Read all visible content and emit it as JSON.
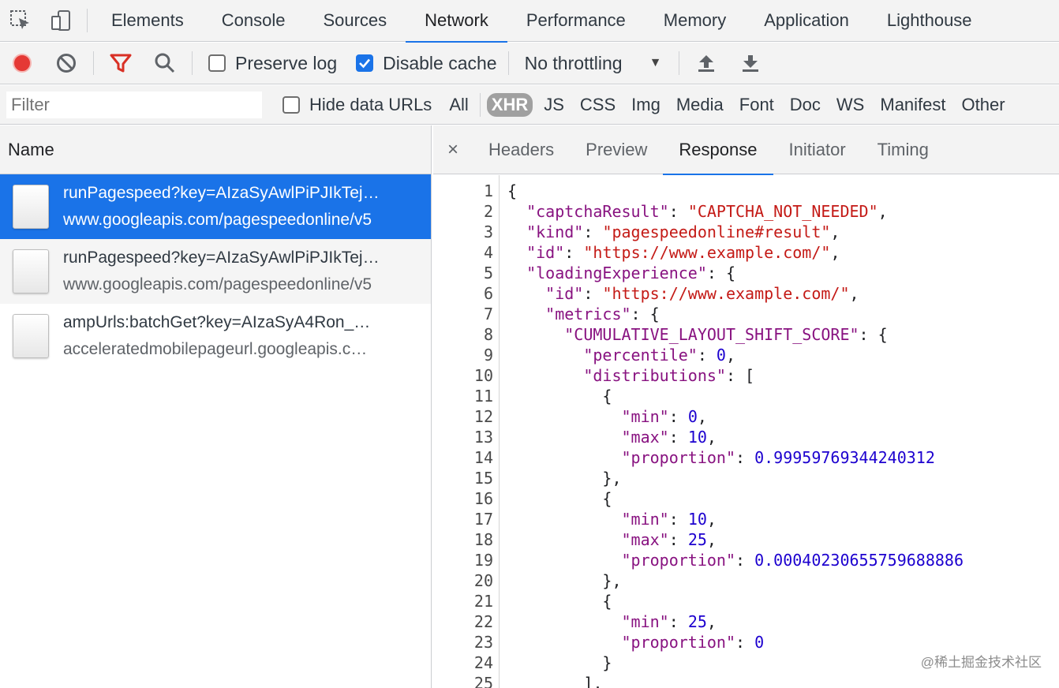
{
  "tabbar": {
    "tabs": [
      "Elements",
      "Console",
      "Sources",
      "Network",
      "Performance",
      "Memory",
      "Application",
      "Lighthouse"
    ],
    "active": "Network"
  },
  "toolbar": {
    "preserve_log": "Preserve log",
    "preserve_log_checked": false,
    "disable_cache": "Disable cache",
    "disable_cache_checked": true,
    "throttling": "No throttling"
  },
  "filterbar": {
    "placeholder": "Filter",
    "hide_data_urls": "Hide data URLs",
    "types": [
      "All",
      "XHR",
      "JS",
      "CSS",
      "Img",
      "Media",
      "Font",
      "Doc",
      "WS",
      "Manifest",
      "Other"
    ],
    "active_type": "XHR"
  },
  "requests": {
    "header": "Name",
    "items": [
      {
        "name": "runPagespeed?key=AIzaSyAwlPiPJIkTej…",
        "url": "www.googleapis.com/pagespeedonline/v5",
        "selected": true
      },
      {
        "name": "runPagespeed?key=AIzaSyAwlPiPJIkTej…",
        "url": "www.googleapis.com/pagespeedonline/v5",
        "selected": false
      },
      {
        "name": "ampUrls:batchGet?key=AIzaSyA4Ron_…",
        "url": "acceleratedmobilepageurl.googleapis.c…",
        "selected": false
      }
    ]
  },
  "detail": {
    "close": "×",
    "tabs": [
      "Headers",
      "Preview",
      "Response",
      "Initiator",
      "Timing"
    ],
    "active": "Response"
  },
  "code_lines": [
    {
      "n": "1",
      "tokens": [
        [
          "p",
          "{"
        ]
      ]
    },
    {
      "n": "2",
      "tokens": [
        [
          "p",
          "  "
        ],
        [
          "k",
          "\"captchaResult\""
        ],
        [
          "p",
          ": "
        ],
        [
          "s",
          "\"CAPTCHA_NOT_NEEDED\""
        ],
        [
          "p",
          ","
        ]
      ]
    },
    {
      "n": "3",
      "tokens": [
        [
          "p",
          "  "
        ],
        [
          "k",
          "\"kind\""
        ],
        [
          "p",
          ": "
        ],
        [
          "s",
          "\"pagespeedonline#result\""
        ],
        [
          "p",
          ","
        ]
      ]
    },
    {
      "n": "4",
      "tokens": [
        [
          "p",
          "  "
        ],
        [
          "k",
          "\"id\""
        ],
        [
          "p",
          ": "
        ],
        [
          "s",
          "\"https://www.example.com/\""
        ],
        [
          "p",
          ","
        ]
      ]
    },
    {
      "n": "5",
      "tokens": [
        [
          "p",
          "  "
        ],
        [
          "k",
          "\"loadingExperience\""
        ],
        [
          "p",
          ": {"
        ]
      ]
    },
    {
      "n": "6",
      "tokens": [
        [
          "p",
          "    "
        ],
        [
          "k",
          "\"id\""
        ],
        [
          "p",
          ": "
        ],
        [
          "s",
          "\"https://www.example.com/\""
        ],
        [
          "p",
          ","
        ]
      ]
    },
    {
      "n": "7",
      "tokens": [
        [
          "p",
          "    "
        ],
        [
          "k",
          "\"metrics\""
        ],
        [
          "p",
          ": {"
        ]
      ]
    },
    {
      "n": "8",
      "tokens": [
        [
          "p",
          "      "
        ],
        [
          "k",
          "\"CUMULATIVE_LAYOUT_SHIFT_SCORE\""
        ],
        [
          "p",
          ": {"
        ]
      ]
    },
    {
      "n": "9",
      "tokens": [
        [
          "p",
          "        "
        ],
        [
          "k",
          "\"percentile\""
        ],
        [
          "p",
          ": "
        ],
        [
          "n",
          "0"
        ],
        [
          "p",
          ","
        ]
      ]
    },
    {
      "n": "10",
      "tokens": [
        [
          "p",
          "        "
        ],
        [
          "k",
          "\"distributions\""
        ],
        [
          "p",
          ": ["
        ]
      ]
    },
    {
      "n": "11",
      "tokens": [
        [
          "p",
          "          {"
        ]
      ]
    },
    {
      "n": "12",
      "tokens": [
        [
          "p",
          "            "
        ],
        [
          "k",
          "\"min\""
        ],
        [
          "p",
          ": "
        ],
        [
          "n",
          "0"
        ],
        [
          "p",
          ","
        ]
      ]
    },
    {
      "n": "13",
      "tokens": [
        [
          "p",
          "            "
        ],
        [
          "k",
          "\"max\""
        ],
        [
          "p",
          ": "
        ],
        [
          "n",
          "10"
        ],
        [
          "p",
          ","
        ]
      ]
    },
    {
      "n": "14",
      "tokens": [
        [
          "p",
          "            "
        ],
        [
          "k",
          "\"proportion\""
        ],
        [
          "p",
          ": "
        ],
        [
          "n",
          "0.99959769344240312"
        ]
      ]
    },
    {
      "n": "15",
      "tokens": [
        [
          "p",
          "          },"
        ]
      ]
    },
    {
      "n": "16",
      "tokens": [
        [
          "p",
          "          {"
        ]
      ]
    },
    {
      "n": "17",
      "tokens": [
        [
          "p",
          "            "
        ],
        [
          "k",
          "\"min\""
        ],
        [
          "p",
          ": "
        ],
        [
          "n",
          "10"
        ],
        [
          "p",
          ","
        ]
      ]
    },
    {
      "n": "18",
      "tokens": [
        [
          "p",
          "            "
        ],
        [
          "k",
          "\"max\""
        ],
        [
          "p",
          ": "
        ],
        [
          "n",
          "25"
        ],
        [
          "p",
          ","
        ]
      ]
    },
    {
      "n": "19",
      "tokens": [
        [
          "p",
          "            "
        ],
        [
          "k",
          "\"proportion\""
        ],
        [
          "p",
          ": "
        ],
        [
          "n",
          "0.00040230655759688886"
        ]
      ]
    },
    {
      "n": "20",
      "tokens": [
        [
          "p",
          "          },"
        ]
      ]
    },
    {
      "n": "21",
      "tokens": [
        [
          "p",
          "          {"
        ]
      ]
    },
    {
      "n": "22",
      "tokens": [
        [
          "p",
          "            "
        ],
        [
          "k",
          "\"min\""
        ],
        [
          "p",
          ": "
        ],
        [
          "n",
          "25"
        ],
        [
          "p",
          ","
        ]
      ]
    },
    {
      "n": "23",
      "tokens": [
        [
          "p",
          "            "
        ],
        [
          "k",
          "\"proportion\""
        ],
        [
          "p",
          ": "
        ],
        [
          "n",
          "0"
        ]
      ]
    },
    {
      "n": "24",
      "tokens": [
        [
          "p",
          "          }"
        ]
      ]
    },
    {
      "n": "25",
      "tokens": [
        [
          "p",
          "        ],"
        ]
      ]
    }
  ],
  "watermark": "@稀土掘金技术社区",
  "colors": {
    "accent": "#1a73e8",
    "record": "#e53935",
    "filter_icon": "#d93025"
  }
}
